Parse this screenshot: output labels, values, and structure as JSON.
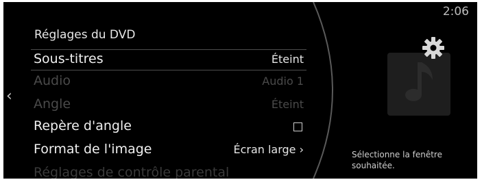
{
  "status": {
    "time": "2:06"
  },
  "menu": {
    "title": "Réglages du DVD",
    "rows": [
      {
        "label": "Sous-titres",
        "value": "Éteint"
      },
      {
        "label": "Audio",
        "value": "Audio 1"
      },
      {
        "label": "Angle",
        "value": "Éteint"
      },
      {
        "label": "Repère d'angle",
        "checked": false
      },
      {
        "label": "Format de l'image",
        "value": "Écran large ›"
      },
      {
        "label": "Réglages de contrôle parental"
      }
    ]
  },
  "info_panel": {
    "hint": "Sélectionne la fenêtre souhaitée."
  },
  "icons": {
    "back": "chevron-left-icon",
    "settings": "gear-icon",
    "media": "music-note-icon"
  },
  "colors": {
    "background": "#000000",
    "text": "#f0f0f0",
    "disabled_text": "#4a4a4a"
  }
}
